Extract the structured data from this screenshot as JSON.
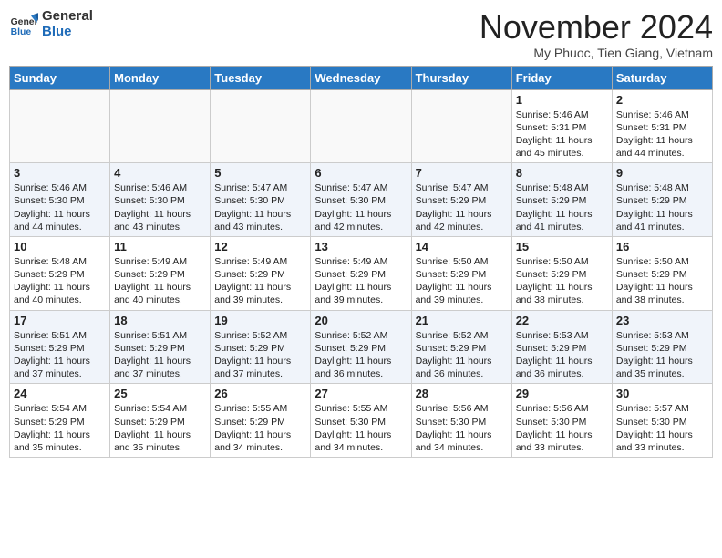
{
  "header": {
    "logo_line1": "General",
    "logo_line2": "Blue",
    "month": "November 2024",
    "location": "My Phuoc, Tien Giang, Vietnam"
  },
  "weekdays": [
    "Sunday",
    "Monday",
    "Tuesday",
    "Wednesday",
    "Thursday",
    "Friday",
    "Saturday"
  ],
  "weeks": [
    [
      {
        "day": "",
        "info": ""
      },
      {
        "day": "",
        "info": ""
      },
      {
        "day": "",
        "info": ""
      },
      {
        "day": "",
        "info": ""
      },
      {
        "day": "",
        "info": ""
      },
      {
        "day": "1",
        "info": "Sunrise: 5:46 AM\nSunset: 5:31 PM\nDaylight: 11 hours\nand 45 minutes."
      },
      {
        "day": "2",
        "info": "Sunrise: 5:46 AM\nSunset: 5:31 PM\nDaylight: 11 hours\nand 44 minutes."
      }
    ],
    [
      {
        "day": "3",
        "info": "Sunrise: 5:46 AM\nSunset: 5:30 PM\nDaylight: 11 hours\nand 44 minutes."
      },
      {
        "day": "4",
        "info": "Sunrise: 5:46 AM\nSunset: 5:30 PM\nDaylight: 11 hours\nand 43 minutes."
      },
      {
        "day": "5",
        "info": "Sunrise: 5:47 AM\nSunset: 5:30 PM\nDaylight: 11 hours\nand 43 minutes."
      },
      {
        "day": "6",
        "info": "Sunrise: 5:47 AM\nSunset: 5:30 PM\nDaylight: 11 hours\nand 42 minutes."
      },
      {
        "day": "7",
        "info": "Sunrise: 5:47 AM\nSunset: 5:29 PM\nDaylight: 11 hours\nand 42 minutes."
      },
      {
        "day": "8",
        "info": "Sunrise: 5:48 AM\nSunset: 5:29 PM\nDaylight: 11 hours\nand 41 minutes."
      },
      {
        "day": "9",
        "info": "Sunrise: 5:48 AM\nSunset: 5:29 PM\nDaylight: 11 hours\nand 41 minutes."
      }
    ],
    [
      {
        "day": "10",
        "info": "Sunrise: 5:48 AM\nSunset: 5:29 PM\nDaylight: 11 hours\nand 40 minutes."
      },
      {
        "day": "11",
        "info": "Sunrise: 5:49 AM\nSunset: 5:29 PM\nDaylight: 11 hours\nand 40 minutes."
      },
      {
        "day": "12",
        "info": "Sunrise: 5:49 AM\nSunset: 5:29 PM\nDaylight: 11 hours\nand 39 minutes."
      },
      {
        "day": "13",
        "info": "Sunrise: 5:49 AM\nSunset: 5:29 PM\nDaylight: 11 hours\nand 39 minutes."
      },
      {
        "day": "14",
        "info": "Sunrise: 5:50 AM\nSunset: 5:29 PM\nDaylight: 11 hours\nand 39 minutes."
      },
      {
        "day": "15",
        "info": "Sunrise: 5:50 AM\nSunset: 5:29 PM\nDaylight: 11 hours\nand 38 minutes."
      },
      {
        "day": "16",
        "info": "Sunrise: 5:50 AM\nSunset: 5:29 PM\nDaylight: 11 hours\nand 38 minutes."
      }
    ],
    [
      {
        "day": "17",
        "info": "Sunrise: 5:51 AM\nSunset: 5:29 PM\nDaylight: 11 hours\nand 37 minutes."
      },
      {
        "day": "18",
        "info": "Sunrise: 5:51 AM\nSunset: 5:29 PM\nDaylight: 11 hours\nand 37 minutes."
      },
      {
        "day": "19",
        "info": "Sunrise: 5:52 AM\nSunset: 5:29 PM\nDaylight: 11 hours\nand 37 minutes."
      },
      {
        "day": "20",
        "info": "Sunrise: 5:52 AM\nSunset: 5:29 PM\nDaylight: 11 hours\nand 36 minutes."
      },
      {
        "day": "21",
        "info": "Sunrise: 5:52 AM\nSunset: 5:29 PM\nDaylight: 11 hours\nand 36 minutes."
      },
      {
        "day": "22",
        "info": "Sunrise: 5:53 AM\nSunset: 5:29 PM\nDaylight: 11 hours\nand 36 minutes."
      },
      {
        "day": "23",
        "info": "Sunrise: 5:53 AM\nSunset: 5:29 PM\nDaylight: 11 hours\nand 35 minutes."
      }
    ],
    [
      {
        "day": "24",
        "info": "Sunrise: 5:54 AM\nSunset: 5:29 PM\nDaylight: 11 hours\nand 35 minutes."
      },
      {
        "day": "25",
        "info": "Sunrise: 5:54 AM\nSunset: 5:29 PM\nDaylight: 11 hours\nand 35 minutes."
      },
      {
        "day": "26",
        "info": "Sunrise: 5:55 AM\nSunset: 5:29 PM\nDaylight: 11 hours\nand 34 minutes."
      },
      {
        "day": "27",
        "info": "Sunrise: 5:55 AM\nSunset: 5:30 PM\nDaylight: 11 hours\nand 34 minutes."
      },
      {
        "day": "28",
        "info": "Sunrise: 5:56 AM\nSunset: 5:30 PM\nDaylight: 11 hours\nand 34 minutes."
      },
      {
        "day": "29",
        "info": "Sunrise: 5:56 AM\nSunset: 5:30 PM\nDaylight: 11 hours\nand 33 minutes."
      },
      {
        "day": "30",
        "info": "Sunrise: 5:57 AM\nSunset: 5:30 PM\nDaylight: 11 hours\nand 33 minutes."
      }
    ]
  ]
}
